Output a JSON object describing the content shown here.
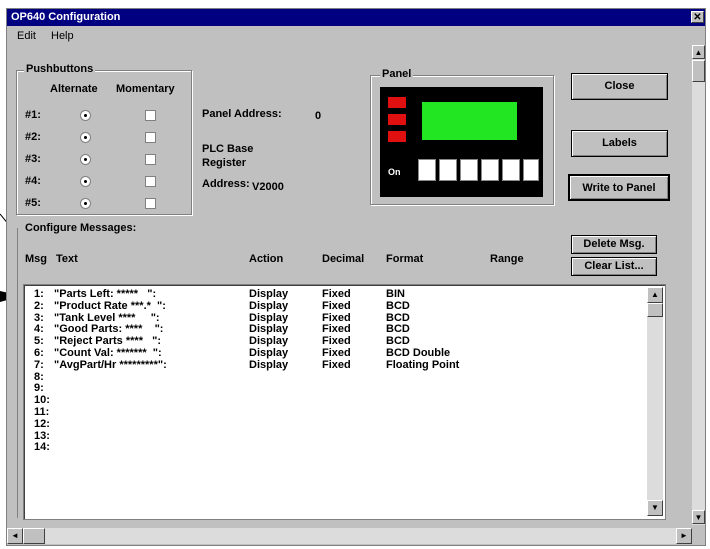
{
  "window": {
    "title": "OP640 Configuration",
    "close_glyph": "✕"
  },
  "menu": [
    {
      "label": "Edit"
    },
    {
      "label": "Help"
    }
  ],
  "pushbuttons": {
    "group_label": "Pushbuttons",
    "col_alternate": "Alternate",
    "col_momentary": "Momentary",
    "rows": [
      {
        "label": "#1:",
        "mode": "Alternate"
      },
      {
        "label": "#2:",
        "mode": "Alternate"
      },
      {
        "label": "#3:",
        "mode": "Alternate"
      },
      {
        "label": "#4:",
        "mode": "Alternate"
      },
      {
        "label": "#5:",
        "mode": "Alternate"
      }
    ]
  },
  "panel_address": {
    "label": "Panel Address:",
    "value": "0"
  },
  "plc": {
    "line1": "PLC Base",
    "line2": "Register",
    "line3": "Address:",
    "value": "V2000"
  },
  "panel": {
    "group_label": "Panel",
    "screen_color": "#22e622",
    "led_color": "#e01010",
    "keys_label": "On"
  },
  "buttons": {
    "close": "Close",
    "labels": "Labels",
    "write": "Write to Panel",
    "delete": "Delete Msg.",
    "clear": "Clear List..."
  },
  "messages": {
    "group_label": "Configure Messages:",
    "headers": {
      "msg": "Msg",
      "text": "Text",
      "action": "Action",
      "decimal": "Decimal",
      "format": "Format",
      "range": "Range"
    },
    "rows": [
      {
        "num": "1:",
        "text": "\"Parts Left: *****   \":",
        "action": "Display",
        "decimal": "Fixed",
        "format": "BIN"
      },
      {
        "num": "2:",
        "text": "\"Product Rate ***.*  \":",
        "action": "Display",
        "decimal": "Fixed",
        "format": "BCD"
      },
      {
        "num": "3:",
        "text": "\"Tank Level ****     \":",
        "action": "Display",
        "decimal": "Fixed",
        "format": "BCD"
      },
      {
        "num": "4:",
        "text": "\"Good Parts: ****    \":",
        "action": "Display",
        "decimal": "Fixed",
        "format": "BCD"
      },
      {
        "num": "5:",
        "text": "\"Reject Parts ****   \":",
        "action": "Display",
        "decimal": "Fixed",
        "format": "BCD"
      },
      {
        "num": "6:",
        "text": "\"Count Val: *******  \":",
        "action": "Display",
        "decimal": "Fixed",
        "format": "BCD Double"
      },
      {
        "num": "7:",
        "text": "\"AvgPart/Hr *********\":",
        "action": "Display",
        "decimal": "Fixed",
        "format": "Floating Point"
      },
      {
        "num": "8:",
        "text": "",
        "action": "",
        "decimal": "",
        "format": ""
      },
      {
        "num": "9:",
        "text": "",
        "action": "",
        "decimal": "",
        "format": ""
      },
      {
        "num": "10:",
        "text": "",
        "action": "",
        "decimal": "",
        "format": ""
      },
      {
        "num": "11:",
        "text": "",
        "action": "",
        "decimal": "",
        "format": ""
      },
      {
        "num": "12:",
        "text": "",
        "action": "",
        "decimal": "",
        "format": ""
      },
      {
        "num": "13:",
        "text": "",
        "action": "",
        "decimal": "",
        "format": ""
      },
      {
        "num": "14:",
        "text": "",
        "action": "",
        "decimal": "",
        "format": ""
      }
    ]
  },
  "scroll": {
    "up": "▲",
    "down": "▼",
    "left": "◄",
    "right": "►"
  }
}
